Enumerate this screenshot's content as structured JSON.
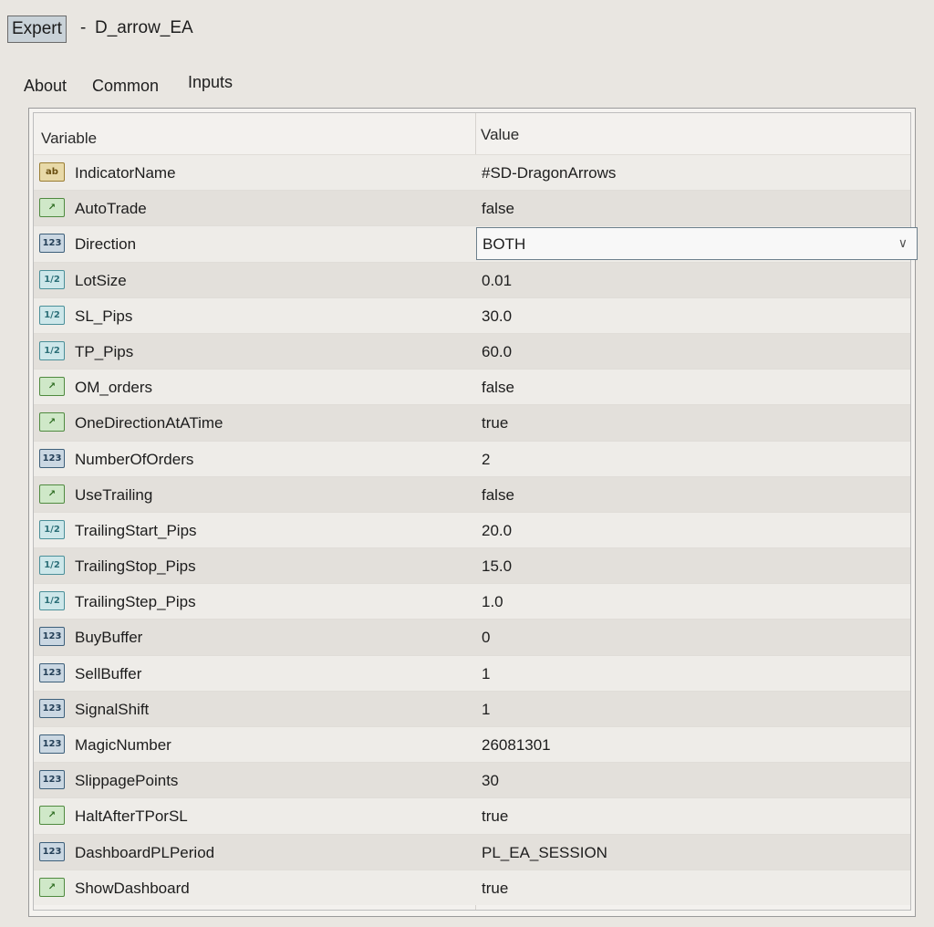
{
  "window": {
    "title_prefix": "Expert",
    "separator": "-",
    "title": "D_arrow_EA"
  },
  "tabs": [
    {
      "label": "About"
    },
    {
      "label": "Common"
    },
    {
      "label": "Inputs"
    }
  ],
  "grid": {
    "columns": {
      "variable": "Variable",
      "value": "Value"
    },
    "rows": [
      {
        "name": "IndicatorName",
        "value": "#SD-DragonArrows",
        "type": "string",
        "icon": "ab"
      },
      {
        "name": "AutoTrade",
        "value": "false",
        "type": "bool",
        "icon": "bool"
      },
      {
        "name": "Direction",
        "value": "BOTH",
        "type": "enum",
        "icon": "123"
      },
      {
        "name": "LotSize",
        "value": "0.01",
        "type": "double",
        "icon": "1/2"
      },
      {
        "name": "SL_Pips",
        "value": "30.0",
        "type": "double",
        "icon": "1/2"
      },
      {
        "name": "TP_Pips",
        "value": "60.0",
        "type": "double",
        "icon": "1/2"
      },
      {
        "name": "OM_orders",
        "value": "false",
        "type": "bool",
        "icon": "bool"
      },
      {
        "name": "OneDirectionAtATime",
        "value": "true",
        "type": "bool",
        "icon": "bool"
      },
      {
        "name": "NumberOfOrders",
        "value": "2",
        "type": "int",
        "icon": "123"
      },
      {
        "name": "UseTrailing",
        "value": "false",
        "type": "bool",
        "icon": "bool"
      },
      {
        "name": "TrailingStart_Pips",
        "value": "20.0",
        "type": "double",
        "icon": "1/2"
      },
      {
        "name": "TrailingStop_Pips",
        "value": "15.0",
        "type": "double",
        "icon": "1/2"
      },
      {
        "name": "TrailingStep_Pips",
        "value": "1.0",
        "type": "double",
        "icon": "1/2"
      },
      {
        "name": "BuyBuffer",
        "value": "0",
        "type": "int",
        "icon": "123"
      },
      {
        "name": "SellBuffer",
        "value": "1",
        "type": "int",
        "icon": "123"
      },
      {
        "name": "SignalShift",
        "value": "1",
        "type": "int",
        "icon": "123"
      },
      {
        "name": "MagicNumber",
        "value": "26081301",
        "type": "int",
        "icon": "123"
      },
      {
        "name": "SlippagePoints",
        "value": "30",
        "type": "int",
        "icon": "123"
      },
      {
        "name": "HaltAfterTPorSL",
        "value": "true",
        "type": "bool",
        "icon": "bool"
      },
      {
        "name": "DashboardPLPeriod",
        "value": "PL_EA_SESSION",
        "type": "enum",
        "icon": "123"
      },
      {
        "name": "ShowDashboard",
        "value": "true",
        "type": "bool",
        "icon": "bool"
      }
    ]
  }
}
